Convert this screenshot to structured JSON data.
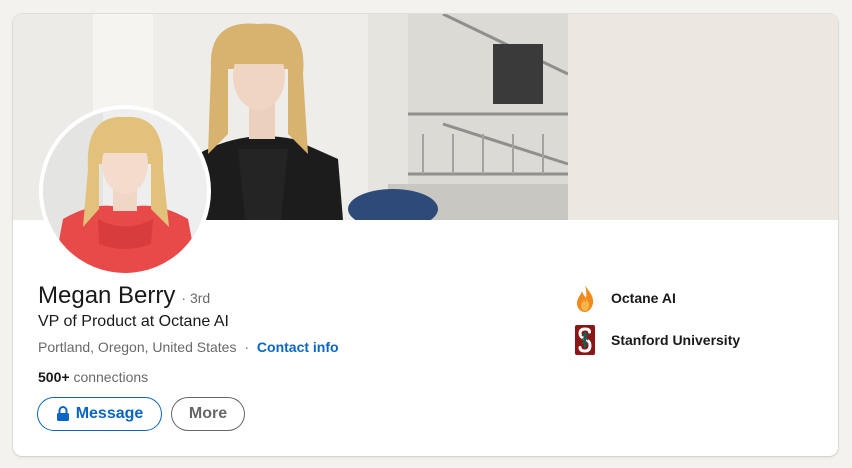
{
  "profile": {
    "name": "Megan Berry",
    "degree": "· 3rd",
    "headline": "VP of Product at Octane AI",
    "location": "Portland, Oregon, United States",
    "separator": "·",
    "contact_label": "Contact info",
    "connections_count": "500+",
    "connections_label": "connections"
  },
  "actions": {
    "message_label": "Message",
    "more_label": "More"
  },
  "organizations": [
    {
      "name": "Octane AI",
      "icon": "flame-logo-icon"
    },
    {
      "name": "Stanford University",
      "icon": "stanford-logo-icon"
    }
  ],
  "colors": {
    "accent": "#0a66c2",
    "page_background": "#f3f2ef",
    "card_background": "#ffffff"
  }
}
